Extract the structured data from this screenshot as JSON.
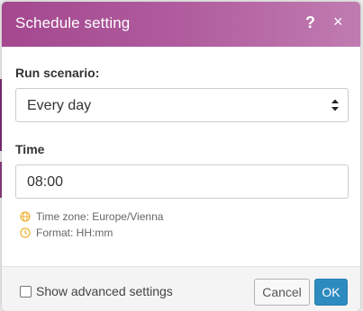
{
  "dialog": {
    "title": "Schedule setting",
    "help_label": "?",
    "close_label": "×"
  },
  "form": {
    "run_scenario_label": "Run scenario:",
    "run_scenario_value": "Every day",
    "time_label": "Time",
    "time_value": "08:00",
    "timezone_hint": "Time zone: Europe/Vienna",
    "format_hint": "Format: HH:mm"
  },
  "footer": {
    "advanced_label": "Show advanced settings",
    "advanced_checked": false,
    "cancel_label": "Cancel",
    "ok_label": "OK"
  },
  "colors": {
    "header": "#a4488f",
    "ok_button": "#2e8bc0",
    "hint_icon": "#f0b030"
  }
}
